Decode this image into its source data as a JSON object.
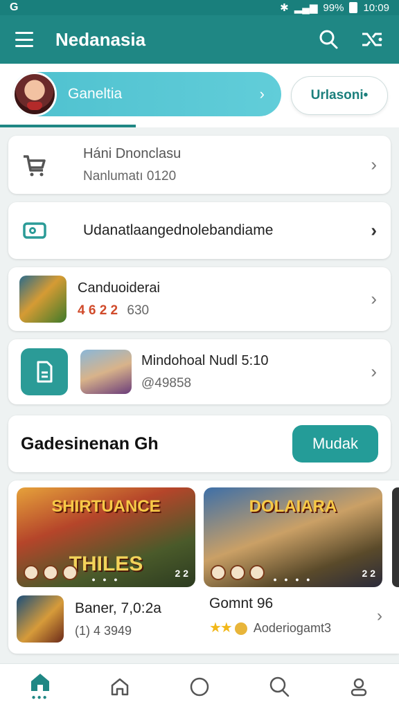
{
  "status": {
    "left": "G",
    "time": "10:09",
    "battery": "99%"
  },
  "appbar": {
    "title": "Nedanasia"
  },
  "profile": {
    "name": "Ganeltia",
    "action_label": "Urlasoni•"
  },
  "items": [
    {
      "icon": "cart-icon",
      "line1": "Háni Dnonclasu",
      "line2": "Nanlumatı 0120"
    },
    {
      "icon": "wallet-icon",
      "line1": "Udanatlaangednolebandiame"
    },
    {
      "icon": "game-thumbnail",
      "line1": "Canduoiderai",
      "line2_highlight": "4 6 2 2",
      "line2": "630"
    },
    {
      "icon": "document-icon",
      "line1": "Mindohoal Nudl 5:10",
      "line2": "@49858"
    }
  ],
  "section": {
    "heading": "Gadesinenan Gh",
    "button_label": "Mudak"
  },
  "games": [
    {
      "banner_title": "SHIRTUANCE",
      "banner_sub": "THILES",
      "banner_count": "2 2",
      "name": "Baner, 7,0:2a",
      "meta": "(1) 4 3949"
    },
    {
      "banner_title": "DOLAIARA",
      "banner_sub": "",
      "banner_count": "2 2",
      "name": "Gomnt 96",
      "meta": "Aoderiogamt3",
      "stars": "★★"
    }
  ],
  "nav": [
    {
      "icon": "home-filled-icon",
      "active": true
    },
    {
      "icon": "home-outline-icon"
    },
    {
      "icon": "circle-icon"
    },
    {
      "icon": "heart-search-icon"
    },
    {
      "icon": "profile-icon"
    }
  ],
  "colors": {
    "primary": "#1f8784",
    "accent": "#4fc1cf",
    "button": "#249c98"
  }
}
